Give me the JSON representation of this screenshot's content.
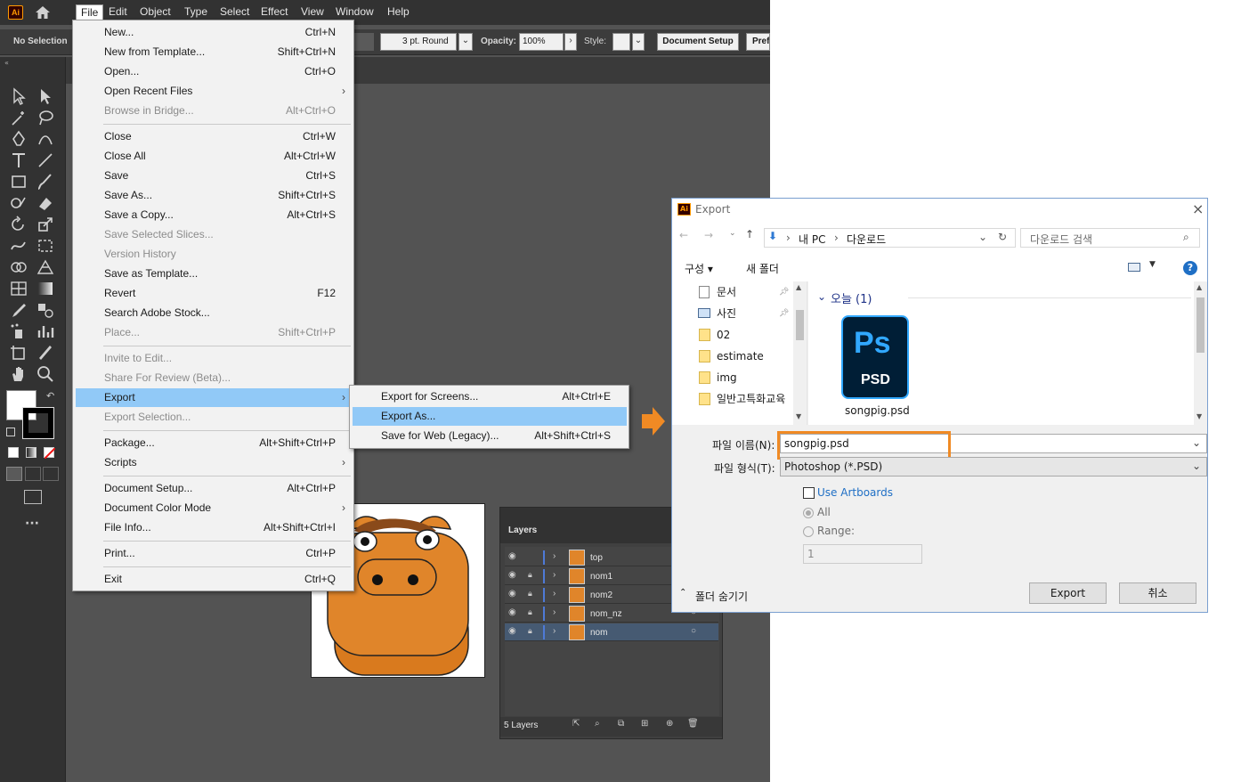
{
  "menubar": {
    "logo": "Ai",
    "items": [
      "File",
      "Edit",
      "Object",
      "Type",
      "Select",
      "Effect",
      "View",
      "Window",
      "Help"
    ]
  },
  "control_bar": {
    "selection": "No Selection",
    "stroke_profile": "3 pt. Round",
    "opacity_label": "Opacity:",
    "opacity_value": "100%",
    "style_label": "Style:",
    "document_setup": "Document Setup",
    "prefs": "Prefe"
  },
  "file_menu": {
    "items": [
      {
        "label": "New...",
        "shortcut": "Ctrl+N"
      },
      {
        "label": "New from Template...",
        "shortcut": "Shift+Ctrl+N"
      },
      {
        "label": "Open...",
        "shortcut": "Ctrl+O"
      },
      {
        "label": "Open Recent Files",
        "shortcut": ""
      },
      {
        "label": "Browse in Bridge...",
        "shortcut": "Alt+Ctrl+O"
      },
      {
        "label": "Close",
        "shortcut": "Ctrl+W"
      },
      {
        "label": "Close All",
        "shortcut": "Alt+Ctrl+W"
      },
      {
        "label": "Save",
        "shortcut": "Ctrl+S"
      },
      {
        "label": "Save As...",
        "shortcut": "Shift+Ctrl+S"
      },
      {
        "label": "Save a Copy...",
        "shortcut": "Alt+Ctrl+S"
      },
      {
        "label": "Save Selected Slices...",
        "shortcut": ""
      },
      {
        "label": "Version History",
        "shortcut": ""
      },
      {
        "label": "Save as Template...",
        "shortcut": ""
      },
      {
        "label": "Revert",
        "shortcut": "F12"
      },
      {
        "label": "Search Adobe Stock...",
        "shortcut": ""
      },
      {
        "label": "Place...",
        "shortcut": "Shift+Ctrl+P"
      },
      {
        "label": "Invite to Edit...",
        "shortcut": ""
      },
      {
        "label": "Share For Review (Beta)...",
        "shortcut": ""
      },
      {
        "label": "Export",
        "shortcut": ""
      },
      {
        "label": "Export Selection...",
        "shortcut": ""
      },
      {
        "label": "Package...",
        "shortcut": "Alt+Shift+Ctrl+P"
      },
      {
        "label": "Scripts",
        "shortcut": ""
      },
      {
        "label": "Document Setup...",
        "shortcut": "Alt+Ctrl+P"
      },
      {
        "label": "Document Color Mode",
        "shortcut": ""
      },
      {
        "label": "File Info...",
        "shortcut": "Alt+Shift+Ctrl+I"
      },
      {
        "label": "Print...",
        "shortcut": "Ctrl+P"
      },
      {
        "label": "Exit",
        "shortcut": "Ctrl+Q"
      }
    ]
  },
  "export_submenu": {
    "items": [
      {
        "label": "Export for Screens...",
        "shortcut": "Alt+Ctrl+E"
      },
      {
        "label": "Export As...",
        "shortcut": ""
      },
      {
        "label": "Save for Web (Legacy)...",
        "shortcut": "Alt+Shift+Ctrl+S"
      }
    ]
  },
  "layers_panel": {
    "title": "Layers",
    "rows": [
      "top",
      "nom1",
      "nom2",
      "nom_nz",
      "nom"
    ],
    "footer": "5 Layers"
  },
  "dialog": {
    "title": "Export",
    "path": [
      "내 PC",
      "다운로드"
    ],
    "search_placeholder": "다운로드 검색",
    "organize": "구성 ▾",
    "new_folder": "새 폴더",
    "help": "?",
    "nav_items": [
      "문서",
      "사진",
      "02",
      "estimate",
      "img",
      "일반고특화교육"
    ],
    "group_header": "오늘 (1)",
    "file_badge": "PSD",
    "file_logo": "Ps",
    "file_name": "songpig.psd",
    "filename_label": "파일 이름(N):",
    "filename_value": "songpig.psd",
    "filetype_label": "파일 형식(T):",
    "filetype_value": "Photoshop (*.PSD)",
    "use_artboards": "Use Artboards",
    "all_label": "All",
    "range_label": "Range:",
    "range_value": "1",
    "hide_folders": "폴더 숨기기",
    "export_button": "Export",
    "cancel_button": "취소"
  },
  "colors": {
    "highlight": "#91c9f7",
    "annotation": "#f08a24",
    "ai_orange": "#ff9a00",
    "ps_blue": "#31a8ff"
  }
}
